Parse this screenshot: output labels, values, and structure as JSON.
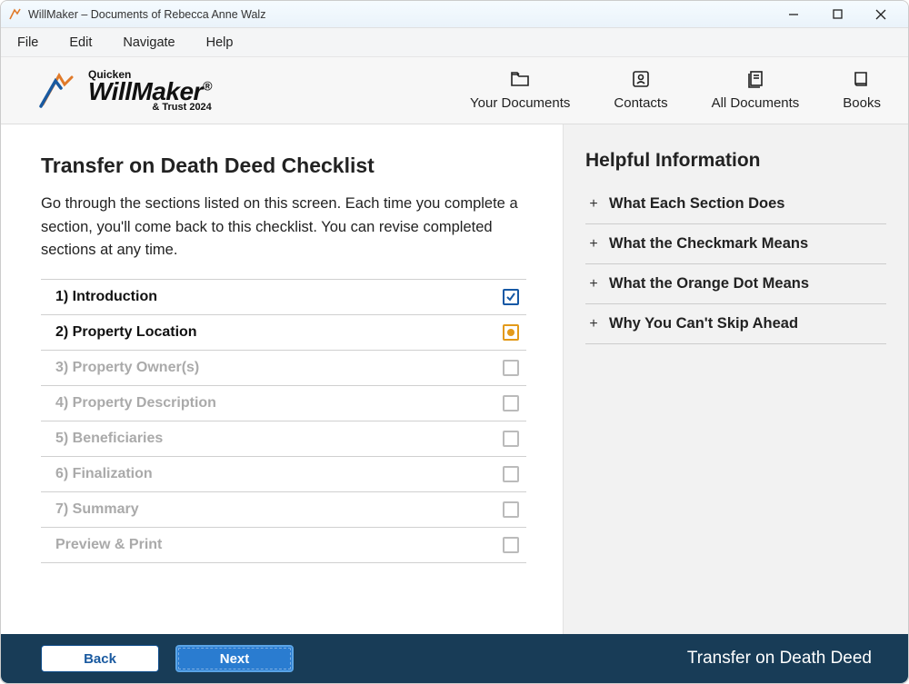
{
  "window": {
    "title": "WillMaker – Documents of Rebecca Anne Walz"
  },
  "menubar": {
    "items": [
      "File",
      "Edit",
      "Navigate",
      "Help"
    ]
  },
  "logo": {
    "brand_small": "Quicken",
    "brand_big": "WillMaker",
    "brand_sub": "& Trust 2024"
  },
  "toolbar": {
    "items": [
      {
        "label": "Your Documents",
        "icon": "folder"
      },
      {
        "label": "Contacts",
        "icon": "contacts"
      },
      {
        "label": "All Documents",
        "icon": "all-docs"
      },
      {
        "label": "Books",
        "icon": "book"
      }
    ]
  },
  "main": {
    "heading": "Transfer on Death Deed Checklist",
    "intro": "Go through the sections listed on this screen. Each time you complete a section, you'll come back to this checklist. You can revise completed sections at any time.",
    "checklist": [
      {
        "label": "1) Introduction",
        "state": "done"
      },
      {
        "label": "2) Property Location",
        "state": "current"
      },
      {
        "label": "3) Property Owner(s)",
        "state": "disabled"
      },
      {
        "label": "4) Property Description",
        "state": "disabled"
      },
      {
        "label": "5) Beneficiaries",
        "state": "disabled"
      },
      {
        "label": "6) Finalization",
        "state": "disabled"
      },
      {
        "label": "7) Summary",
        "state": "disabled"
      },
      {
        "label": "Preview & Print",
        "state": "disabled"
      }
    ]
  },
  "side": {
    "heading": "Helpful Information",
    "items": [
      "What Each Section Does",
      "What the Checkmark Means",
      "What the Orange Dot Means",
      "Why You Can't Skip Ahead"
    ]
  },
  "footer": {
    "back_label": "Back",
    "next_label": "Next",
    "title": "Transfer on Death Deed"
  }
}
